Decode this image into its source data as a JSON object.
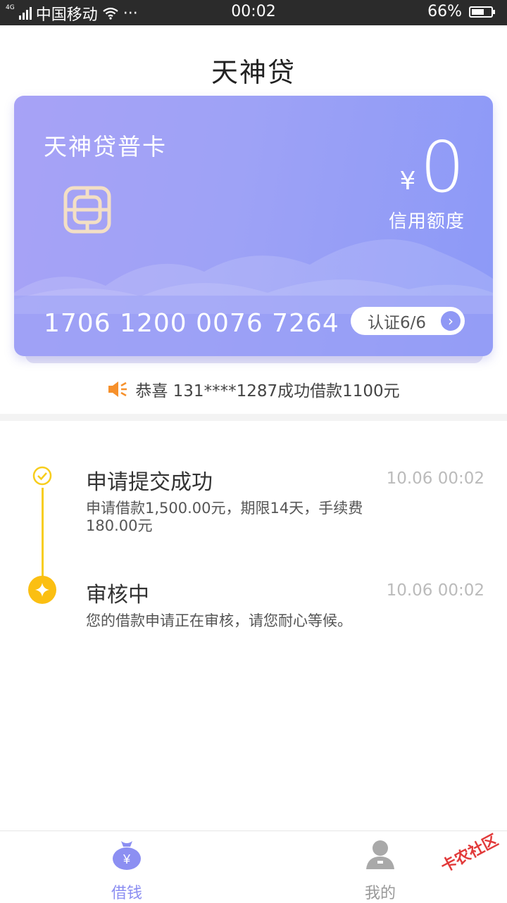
{
  "status_bar": {
    "network": "4G",
    "carrier": "中国移动",
    "more": "···",
    "time": "00:02",
    "battery": "66%",
    "battery_level": 0.66
  },
  "header": {
    "title": "天神贷"
  },
  "card": {
    "name": "天神贷普卡",
    "currency_symbol": "¥",
    "credit_amount": "0",
    "credit_label": "信用额度",
    "card_number": "1706 1200 0076 7264",
    "cert_label": "认证6/6"
  },
  "notice": {
    "text": "恭喜 131****1287成功借款1100元"
  },
  "timeline": [
    {
      "title": "申请提交成功",
      "time": "10.06 00:02",
      "desc_line1": "申请借款1,500.00元，期限14天，手续费",
      "desc_line2": "180.00元"
    },
    {
      "title": "审核中",
      "time": "10.06 00:02",
      "desc_line1": "您的借款申请正在审核，请您耐心等候。"
    }
  ],
  "tabbar": {
    "borrow_label": "借钱",
    "mine_label": "我的"
  },
  "watermark": "卡农社区",
  "colors": {
    "accent": "#8c8ff2",
    "timeline": "#f7cd1c",
    "card_start": "#a7a2f6",
    "card_end": "#8c99f7"
  }
}
